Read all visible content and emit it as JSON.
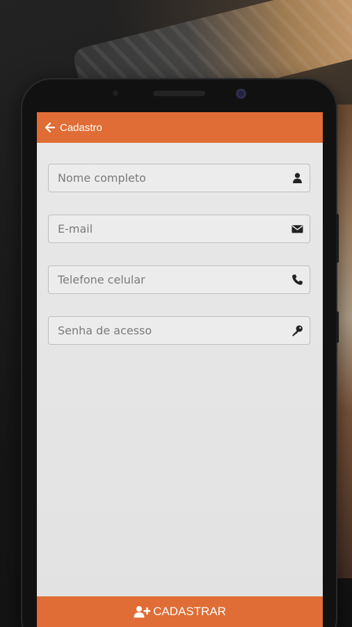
{
  "appbar": {
    "title": "Cadastro",
    "back_icon": "arrow-left-icon"
  },
  "form": {
    "fields": [
      {
        "placeholder": "Nome completo",
        "value": "",
        "icon": "user-icon"
      },
      {
        "placeholder": "E-mail",
        "value": "",
        "icon": "envelope-icon"
      },
      {
        "placeholder": "Telefone celular",
        "value": "",
        "icon": "phone-icon"
      },
      {
        "placeholder": "Senha de acesso",
        "value": "",
        "icon": "key-icon"
      }
    ]
  },
  "submit": {
    "label": "CADASTRAR",
    "icon": "user-plus-icon"
  },
  "colors": {
    "accent": "#e06d35",
    "screen_bg": "#e5e5e5",
    "field_border": "#bdbdbd"
  }
}
